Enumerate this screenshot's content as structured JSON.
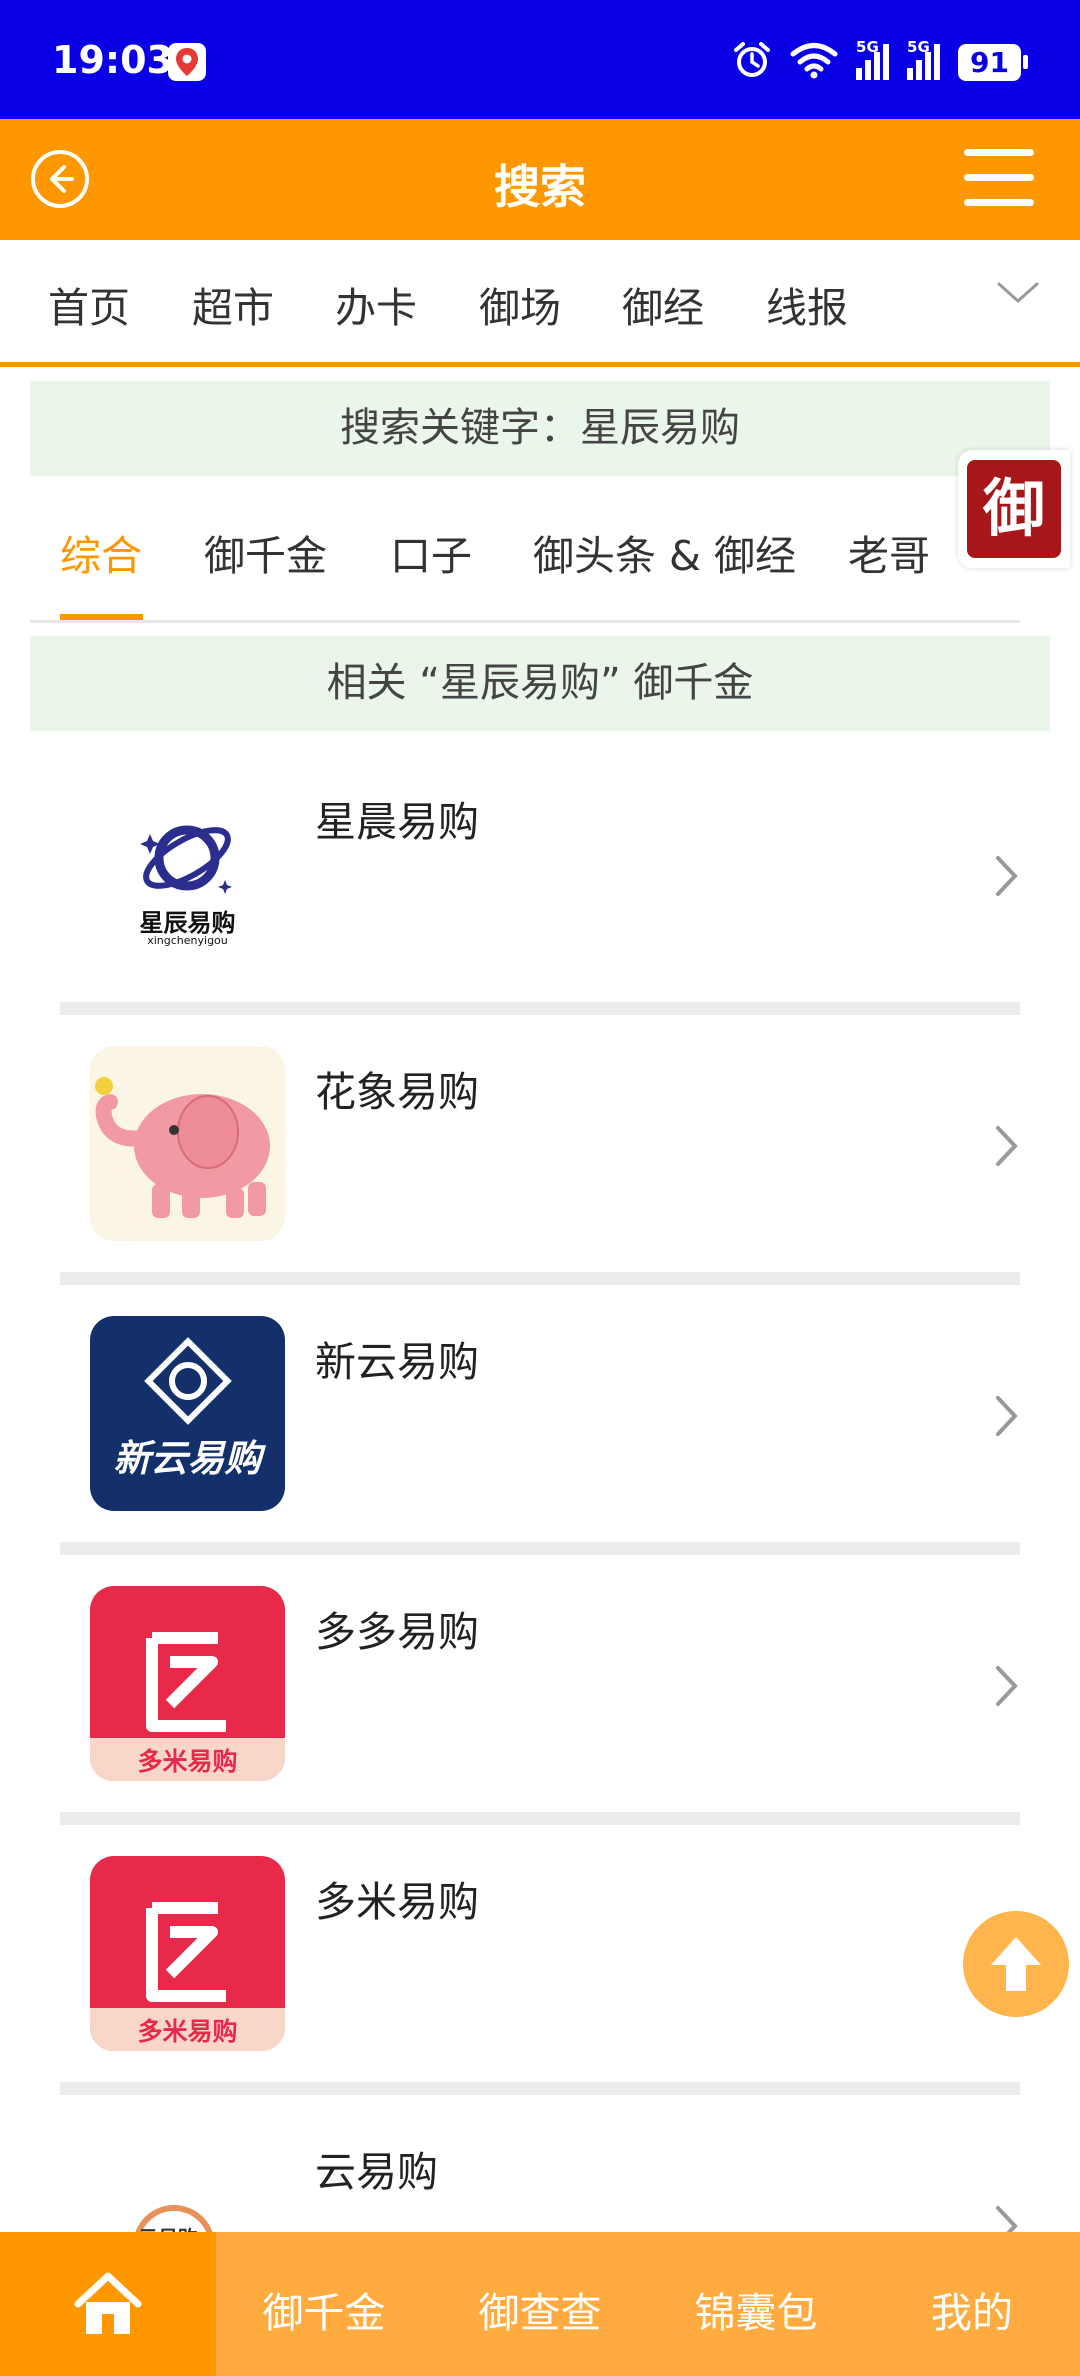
{
  "status_bar": {
    "time": "19:03",
    "network_1": "5G",
    "network_2": "5G",
    "battery": "91"
  },
  "header": {
    "title": "搜索",
    "back_icon": "back-arrow-circle-icon",
    "menu_icon": "hamburger-menu-icon"
  },
  "category_nav": {
    "items": [
      "首页",
      "超市",
      "办卡",
      "御场",
      "御经",
      "线报"
    ],
    "expand_icon": "chevron-down-icon"
  },
  "keyword_banner": {
    "text": "搜索关键字：星辰易购"
  },
  "tabs": {
    "items": [
      "综合",
      "御千金",
      "口子",
      "御头条 & 御经",
      "老哥"
    ],
    "active": "综合"
  },
  "floating_badge": {
    "text": "御"
  },
  "related_banner": {
    "text": "相关 “星辰易购” 御千金"
  },
  "results": [
    {
      "name": "星晨易购",
      "logo_text": "星辰易购",
      "logo_subtext": "xingchenyigou"
    },
    {
      "name": "花象易购"
    },
    {
      "name": "新云易购",
      "logo_text": "新云易购"
    },
    {
      "name": "多多易购",
      "logo_text": "多米易购"
    },
    {
      "name": "多米易购",
      "logo_text": "多米易购"
    },
    {
      "name": "云易购",
      "logo_text": "云易购"
    }
  ],
  "bottom_nav": {
    "items": [
      "御千金",
      "御查查",
      "锦囊包",
      "我的"
    ],
    "home_icon": "home-icon"
  },
  "colors": {
    "status_bar": "#0a00e6",
    "primary": "#ff9800",
    "bottom_nav": "#ffab40",
    "banner_bg": "#eaf6ea"
  }
}
